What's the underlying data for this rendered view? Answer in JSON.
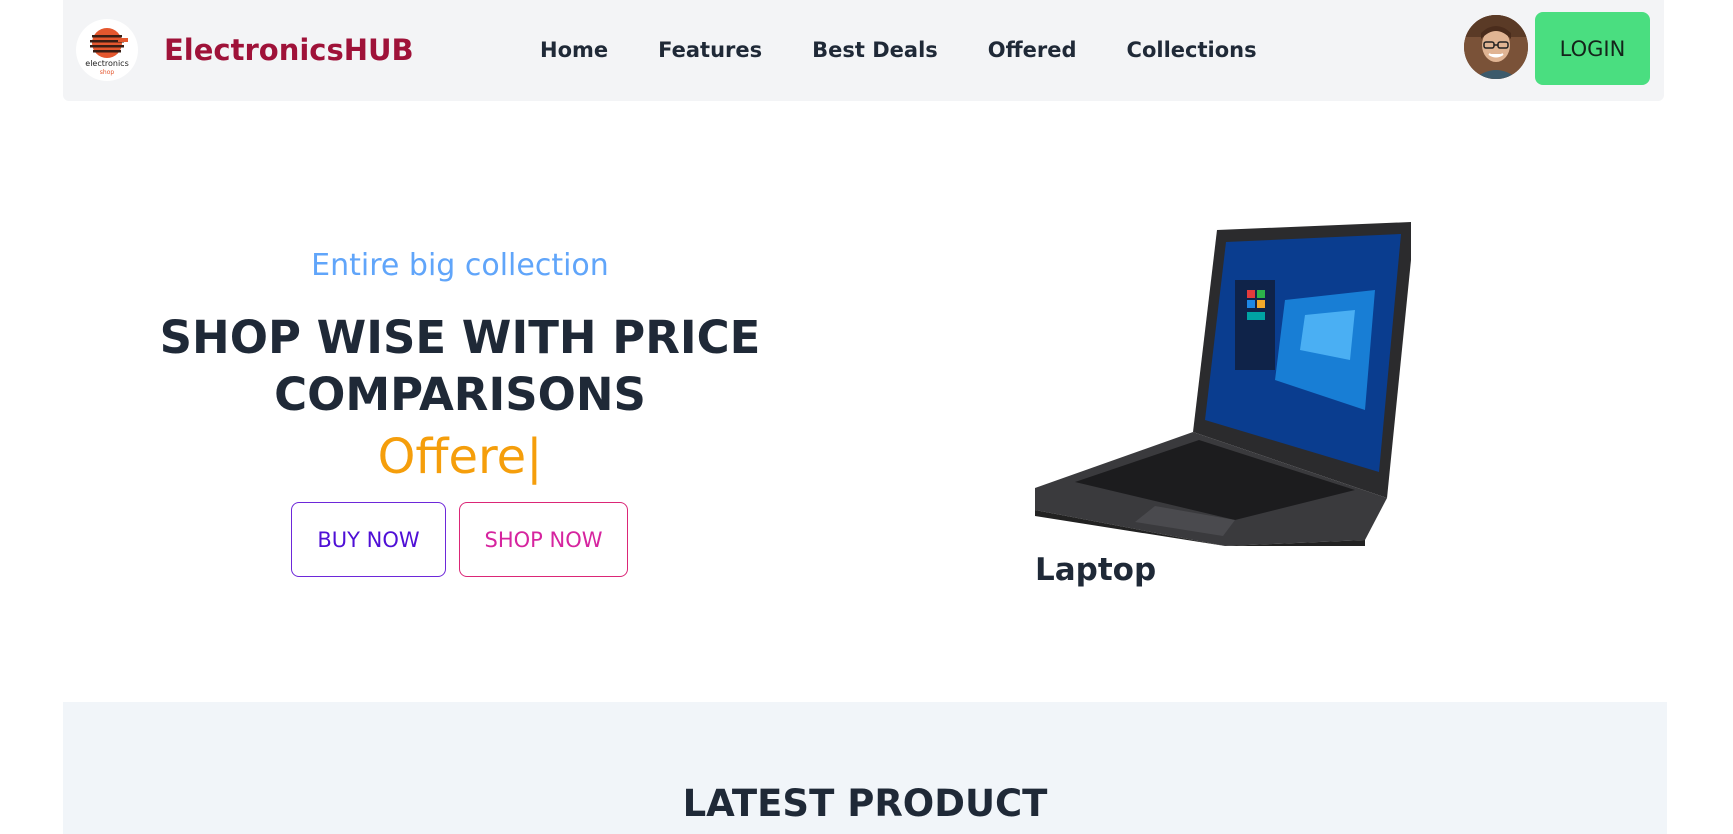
{
  "brand": {
    "name": "ElectronicsHUB",
    "logo_text": "electronics",
    "logo_subtext": "shop",
    "color": "#9f1239"
  },
  "nav": {
    "items": [
      {
        "label": "Home"
      },
      {
        "label": "Features"
      },
      {
        "label": "Best Deals"
      },
      {
        "label": "Offered"
      },
      {
        "label": "Collections"
      }
    ],
    "login_label": "LOGIN",
    "login_color": "#4ade80"
  },
  "hero": {
    "subtitle": "Entire big collection",
    "title": "SHOP WISE WITH PRICE COMPARISONS",
    "typed_text": "Offere",
    "cursor": "|",
    "buy_label": "BUY NOW",
    "shop_label": "SHOP NOW",
    "product_caption": "Laptop"
  },
  "latest": {
    "title": "LATEST PRODUCT"
  },
  "icons": {
    "logo": "electronics-shop-logo",
    "avatar": "user-avatar",
    "product": "laptop-image"
  }
}
